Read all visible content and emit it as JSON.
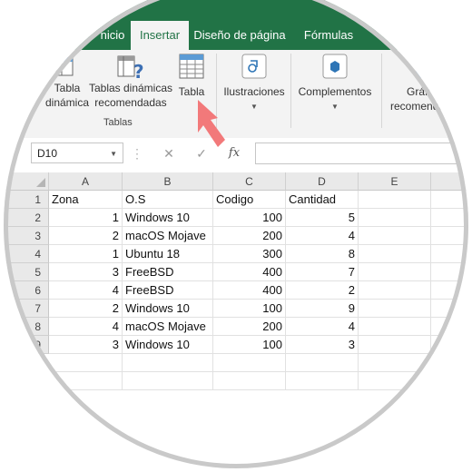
{
  "tabs": {
    "inicio": "nicio",
    "insertar": "Insertar",
    "diseno": "Diseño de página",
    "formulas": "Fórmulas"
  },
  "ribbon": {
    "tabla_dinamica_line1": "Tabla",
    "tabla_dinamica_line2": "dinámica",
    "recomendadas_line1": "Tablas dinámicas",
    "recomendadas_line2": "recomendadas",
    "tabla": "Tabla",
    "group_tablas": "Tablas",
    "ilustraciones": "Ilustraciones",
    "complementos": "Complementos",
    "graficos_line1": "Gráfi",
    "graficos_line2": "recomenda"
  },
  "formula_bar": {
    "name_box": "D10",
    "fx": "fx",
    "cancel": "✕",
    "enter": "✓"
  },
  "columns": [
    "A",
    "B",
    "C",
    "D",
    "E"
  ],
  "rows": [
    {
      "n": "1",
      "a": "Zona",
      "b": "O.S",
      "c": "Codigo",
      "d": "Cantidad"
    },
    {
      "n": "2",
      "a": "1",
      "b": "Windows 10",
      "c": "100",
      "d": "5"
    },
    {
      "n": "3",
      "a": "2",
      "b": "macOS Mojave",
      "c": "200",
      "d": "4"
    },
    {
      "n": "4",
      "a": "1",
      "b": "Ubuntu 18",
      "c": "300",
      "d": "8"
    },
    {
      "n": "5",
      "a": "3",
      "b": "FreeBSD",
      "c": "400",
      "d": "7"
    },
    {
      "n": "6",
      "a": "4",
      "b": "FreeBSD",
      "c": "400",
      "d": "2"
    },
    {
      "n": "7",
      "a": "2",
      "b": "Windows 10",
      "c": "100",
      "d": "9"
    },
    {
      "n": "8",
      "a": "4",
      "b": "macOS Mojave",
      "c": "200",
      "d": "4"
    },
    {
      "n": "9",
      "a": "3",
      "b": "Windows 10",
      "c": "100",
      "d": "3"
    }
  ],
  "colors": {
    "brand_green": "#217346",
    "arrow": "#f2797a"
  }
}
